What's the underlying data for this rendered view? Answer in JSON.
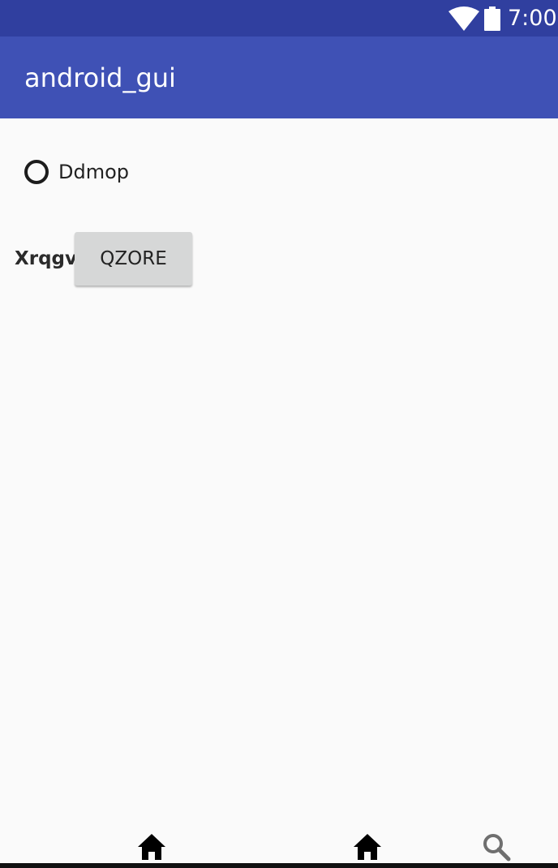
{
  "status_bar": {
    "time": "7:00",
    "wifi_icon": "wifi-icon",
    "battery_icon": "battery-icon",
    "background": "#303f9f"
  },
  "app_bar": {
    "title": "android_gui",
    "background": "#3f51b5"
  },
  "content": {
    "radio": {
      "label": "Ddmop",
      "checked": false
    },
    "field_label": "Xrqgv",
    "button_label": "QZORE"
  },
  "bottom_icons": [
    "home-icon",
    "home-icon",
    "search-icon"
  ]
}
